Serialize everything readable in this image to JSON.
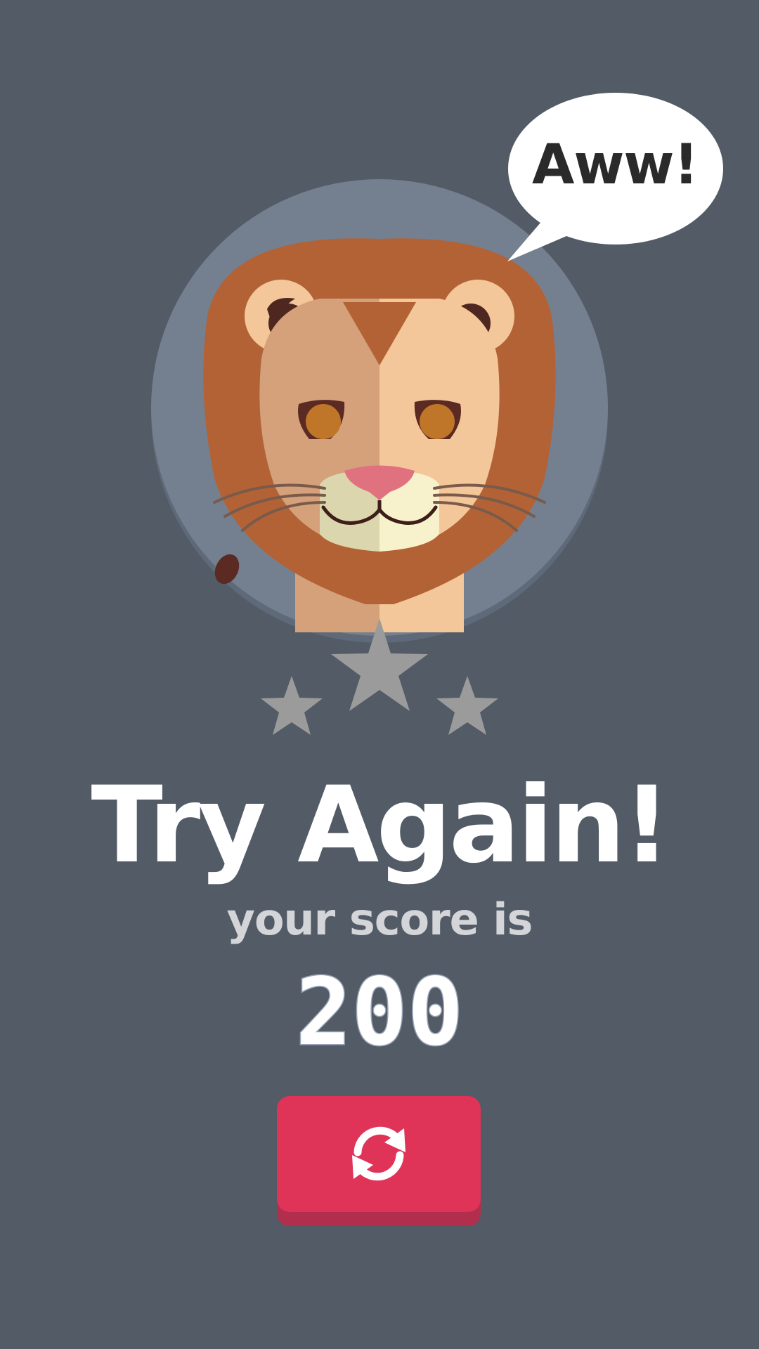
{
  "speech_bubble": {
    "text": "Aww!"
  },
  "result": {
    "title": "Try Again!",
    "subtitle": "your score is",
    "score": "200"
  },
  "rating": {
    "stars_earned": 0,
    "stars_total": 3
  },
  "retry_button": {
    "icon": "refresh-icon",
    "color": "#df3358"
  },
  "colors": {
    "background": "#525b66",
    "title": "#ffffff",
    "subtitle": "#d3d5d8",
    "star_empty": "#9b9b9b",
    "button": "#df3358"
  }
}
